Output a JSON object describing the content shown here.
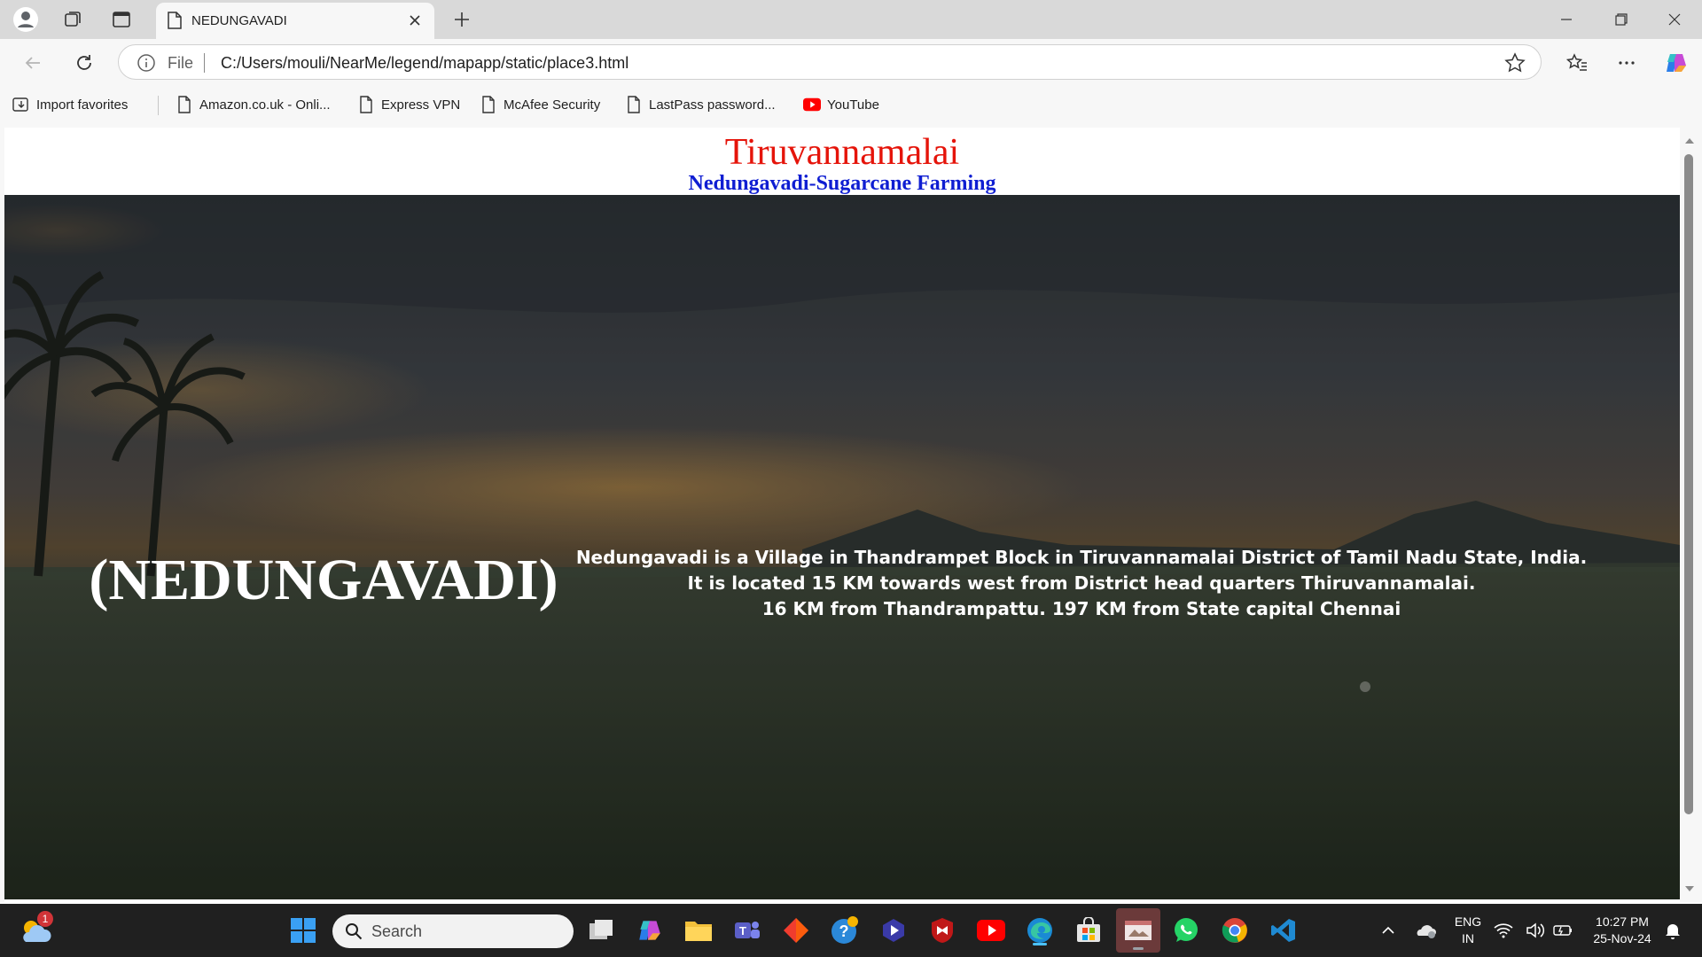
{
  "browser": {
    "tab_title": "NEDUNGAVADI",
    "address_scheme": "File",
    "url": "C:/Users/mouli/NearMe/legend/mapapp/static/place3.html"
  },
  "favorites": [
    {
      "label": "Import favorites"
    },
    {
      "label": "Amazon.co.uk - Onli..."
    },
    {
      "label": "Express VPN"
    },
    {
      "label": "McAfee Security"
    },
    {
      "label": "LastPass password..."
    },
    {
      "label": "YouTube"
    }
  ],
  "page": {
    "title": "Tiruvannamalai",
    "subtitle": "Nedungavadi-Sugarcane Farming",
    "hero_heading": "(NEDUNGAVADI)",
    "description": [
      "Nedungavadi is a Village in Thandrampet Block in Tiruvannamalai District of Tamil Nadu State, India.",
      "It is located 15 KM towards west from District head quarters Thiruvannamalai.",
      "16 KM from Thandrampattu. 197 KM from State capital Chennai"
    ]
  },
  "taskbar": {
    "search_placeholder": "Search",
    "weather_badge": "1",
    "language": "ENG",
    "region": "IN",
    "time": "10:27 PM",
    "date": "25-Nov-24"
  },
  "colors": {
    "title_red": "#e5140a",
    "subtitle_blue": "#0f1ed2",
    "taskbar": "#202020",
    "chrome_bar": "#d9d9d9"
  }
}
